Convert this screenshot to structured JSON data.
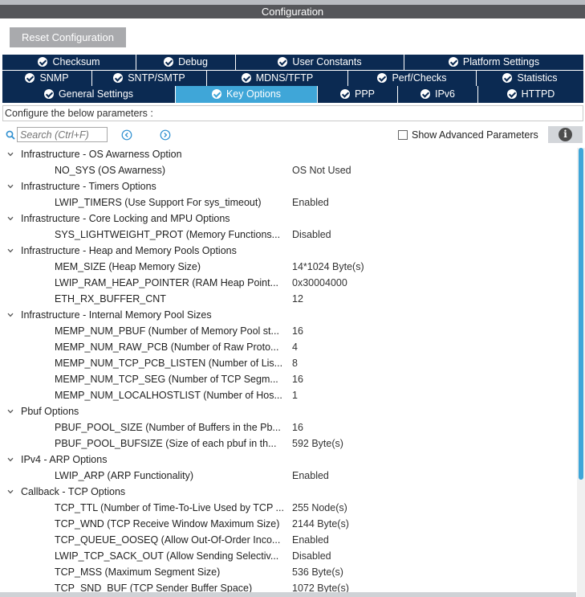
{
  "window": {
    "title": "Configuration"
  },
  "toolbar": {
    "reset_label": "Reset Configuration"
  },
  "tabs": {
    "row1": [
      {
        "label": "Checksum"
      },
      {
        "label": "Debug"
      },
      {
        "label": "User Constants"
      },
      {
        "label": "Platform Settings"
      }
    ],
    "row2": [
      {
        "label": "SNMP"
      },
      {
        "label": "SNTP/SMTP"
      },
      {
        "label": "MDNS/TFTP"
      },
      {
        "label": "Perf/Checks"
      },
      {
        "label": "Statistics"
      }
    ],
    "row3": [
      {
        "label": "General Settings"
      },
      {
        "label": "Key Options"
      },
      {
        "label": "PPP"
      },
      {
        "label": "IPv6"
      },
      {
        "label": "HTTPD"
      }
    ],
    "active": "Key Options"
  },
  "description": "Configure the below parameters :",
  "search": {
    "placeholder": "Search (Ctrl+F)"
  },
  "advanced": {
    "label": "Show Advanced Parameters",
    "checked": false
  },
  "colors": {
    "tab_bg": "#0b2a52",
    "tab_active": "#3fa6d8",
    "title_bg": "#55565a"
  },
  "groups": [
    {
      "label": "Infrastructure - OS Awarness Option",
      "items": [
        {
          "name": "NO_SYS (OS Awarness)",
          "value": "OS Not Used"
        }
      ]
    },
    {
      "label": "Infrastructure - Timers Options",
      "items": [
        {
          "name": "LWIP_TIMERS (Use Support For sys_timeout)",
          "value": "Enabled"
        }
      ]
    },
    {
      "label": "Infrastructure - Core Locking and MPU Options",
      "items": [
        {
          "name": "SYS_LIGHTWEIGHT_PROT (Memory Functions...",
          "value": "Disabled"
        }
      ]
    },
    {
      "label": "Infrastructure - Heap and Memory Pools Options",
      "items": [
        {
          "name": "MEM_SIZE (Heap Memory Size)",
          "value": "14*1024 Byte(s)"
        },
        {
          "name": "LWIP_RAM_HEAP_POINTER (RAM Heap Point...",
          "value": "0x30004000"
        },
        {
          "name": "ETH_RX_BUFFER_CNT",
          "value": "12"
        }
      ]
    },
    {
      "label": "Infrastructure - Internal Memory Pool Sizes",
      "items": [
        {
          "name": "MEMP_NUM_PBUF (Number of Memory Pool st...",
          "value": "16"
        },
        {
          "name": "MEMP_NUM_RAW_PCB (Number of Raw Proto...",
          "value": "4"
        },
        {
          "name": "MEMP_NUM_TCP_PCB_LISTEN (Number of Lis...",
          "value": "8"
        },
        {
          "name": "MEMP_NUM_TCP_SEG (Number of TCP Segm...",
          "value": "16"
        },
        {
          "name": "MEMP_NUM_LOCALHOSTLIST (Number of Hos...",
          "value": "1"
        }
      ]
    },
    {
      "label": "Pbuf Options",
      "items": [
        {
          "name": "PBUF_POOL_SIZE (Number of Buffers in the Pb...",
          "value": "16"
        },
        {
          "name": "PBUF_POOL_BUFSIZE (Size of each pbuf in th...",
          "value": "592 Byte(s)"
        }
      ]
    },
    {
      "label": "IPv4 - ARP Options",
      "items": [
        {
          "name": "LWIP_ARP (ARP Functionality)",
          "value": "Enabled"
        }
      ]
    },
    {
      "label": "Callback - TCP Options",
      "items": [
        {
          "name": "TCP_TTL (Number of Time-To-Live Used by TCP ...",
          "value": "255 Node(s)"
        },
        {
          "name": "TCP_WND (TCP Receive Window Maximum Size)",
          "value": "2144 Byte(s)"
        },
        {
          "name": "TCP_QUEUE_OOSEQ (Allow Out-Of-Order Inco...",
          "value": "Enabled"
        },
        {
          "name": "LWIP_TCP_SACK_OUT (Allow Sending Selectiv...",
          "value": "Disabled"
        },
        {
          "name": "TCP_MSS (Maximum Segment Size)",
          "value": "536 Byte(s)"
        },
        {
          "name": "TCP_SND_BUF (TCP Sender Buffer Space)",
          "value": "1072 Byte(s)"
        }
      ]
    }
  ]
}
